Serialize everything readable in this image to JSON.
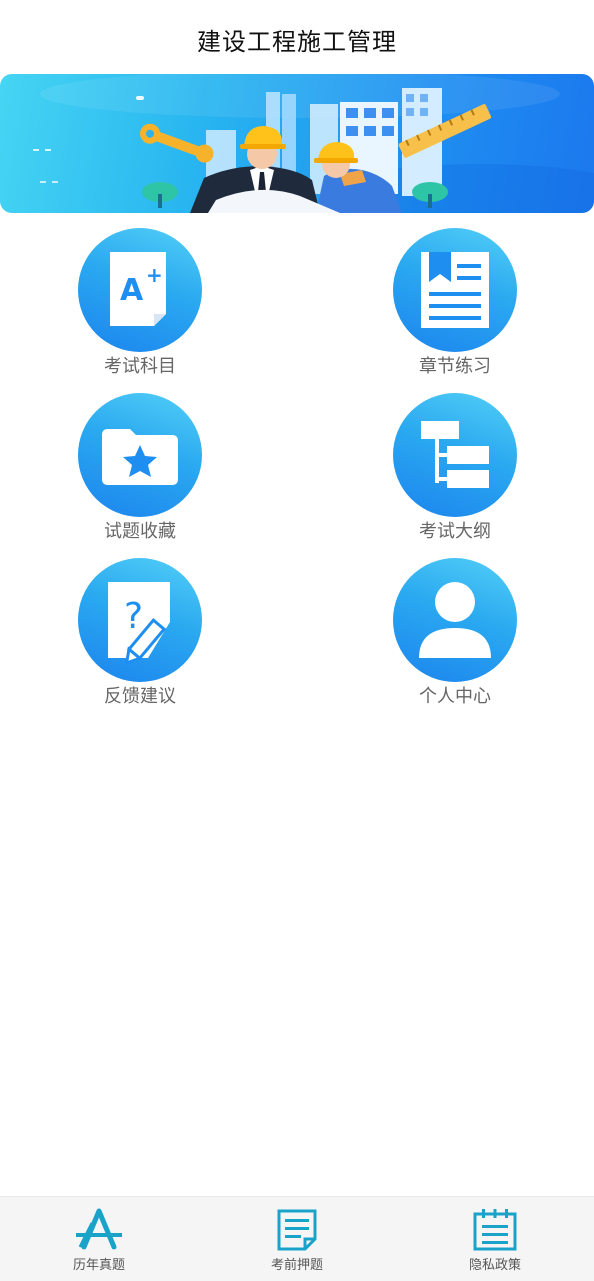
{
  "header": {
    "title": "建设工程施工管理"
  },
  "grid": {
    "items": [
      {
        "label": "考试科目",
        "icon": "exam-subject-icon"
      },
      {
        "label": "章节练习",
        "icon": "chapter-practice-icon"
      },
      {
        "label": "试题收藏",
        "icon": "favorite-folder-icon"
      },
      {
        "label": "考试大纲",
        "icon": "outline-tree-icon"
      },
      {
        "label": "反馈建议",
        "icon": "feedback-icon"
      },
      {
        "label": "个人中心",
        "icon": "user-icon"
      }
    ]
  },
  "tabbar": {
    "items": [
      {
        "label": "历年真题",
        "icon": "past-papers-icon"
      },
      {
        "label": "考前押题",
        "icon": "predicted-questions-icon"
      },
      {
        "label": "隐私政策",
        "icon": "privacy-policy-icon"
      }
    ]
  },
  "colors": {
    "accent": "#1e8ff1",
    "accent_light": "#54d0f7",
    "tab_icon": "#1aa3c9"
  }
}
